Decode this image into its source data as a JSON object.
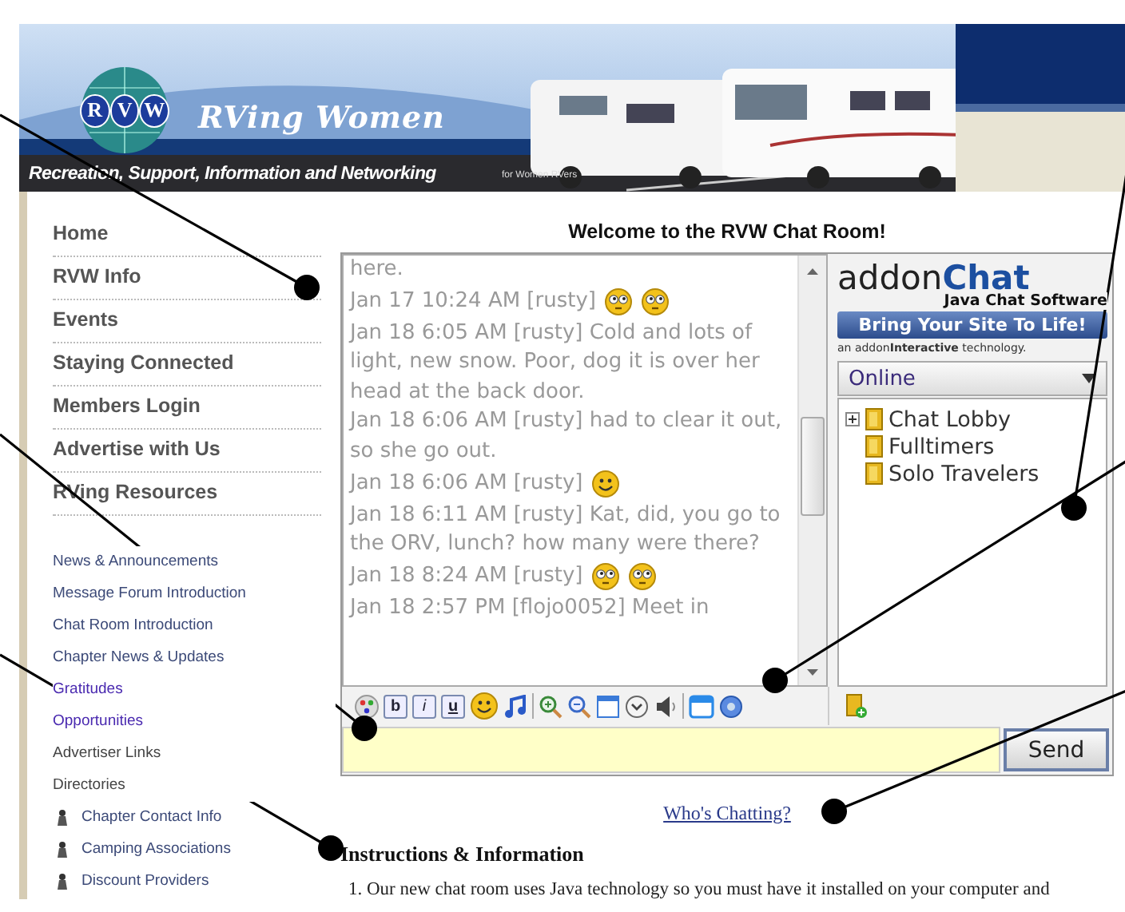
{
  "header": {
    "logo_letters": [
      "R",
      "V",
      "W"
    ],
    "site_name": "RVing Women",
    "tagline": "Recreation, Support, Information and Networking",
    "tagline_note": "for Women RVers"
  },
  "sidebar": {
    "nav": [
      {
        "label": "Home"
      },
      {
        "label": "RVW Info"
      },
      {
        "label": "Events"
      },
      {
        "label": "Staying Connected"
      },
      {
        "label": "Members Login"
      },
      {
        "label": "Advertise with Us"
      },
      {
        "label": "RVing Resources"
      }
    ],
    "links": [
      {
        "label": "News & Announcements",
        "kind": "link",
        "visited": false
      },
      {
        "label": "Message Forum Introduction",
        "kind": "link",
        "visited": false
      },
      {
        "label": "Chat Room Introduction",
        "kind": "link",
        "visited": false
      },
      {
        "label": "Chapter News & Updates",
        "kind": "link",
        "visited": false
      },
      {
        "label": "Gratitudes",
        "kind": "link",
        "visited": true
      },
      {
        "label": "Opportunities",
        "kind": "link",
        "visited": true
      },
      {
        "label": "Advertiser Links",
        "kind": "heading",
        "visited": false
      },
      {
        "label": "Directories",
        "kind": "heading",
        "visited": false
      },
      {
        "label": "Chapter Contact Info",
        "kind": "sub",
        "visited": false
      },
      {
        "label": "Camping Associations",
        "kind": "sub",
        "visited": false
      },
      {
        "label": "Discount Providers",
        "kind": "sub",
        "visited": false
      }
    ]
  },
  "main": {
    "title": "Welcome to the RVW Chat Room!",
    "chat": {
      "messages": [
        {
          "text": "here.",
          "kind": "text"
        },
        {
          "text": "Jan 17 10:24 AM [rusty]",
          "kind": "emote2"
        },
        {
          "text": "Jan 18 6:05 AM [rusty] Cold and lots of light, new snow. Poor, dog it is over her head at the back door.",
          "kind": "text"
        },
        {
          "text": "Jan 18 6:06 AM [rusty] had to clear it out, so she go out.",
          "kind": "text"
        },
        {
          "text": "Jan 18 6:06 AM [rusty]",
          "kind": "emote1"
        },
        {
          "text": "Jan 18 6:11 AM [rusty] Kat, did, you go to the ORV, lunch? how many were there?",
          "kind": "text"
        },
        {
          "text": "Jan 18 8:24 AM [rusty]",
          "kind": "emote2"
        },
        {
          "text": "Jan 18 2:57 PM [flojo0052] Meet in",
          "kind": "text"
        }
      ],
      "format_buttons": [
        "b",
        "i",
        "u"
      ],
      "brand": {
        "name": [
          "addon",
          "Chat"
        ],
        "tagline": "Java Chat Software",
        "banner": "Bring Your Site To Life!",
        "credit": "an addon**Interactive** technology."
      },
      "room_filter": "Online",
      "rooms": [
        {
          "name": "Chat Lobby",
          "expandable": true
        },
        {
          "name": "Fulltimers",
          "expandable": false
        },
        {
          "name": "Solo Travelers",
          "expandable": false
        }
      ],
      "send_label": "Send"
    },
    "whos_chatting": "Who's Chatting?",
    "instructions": {
      "heading": "Instructions & Information",
      "items": [
        "1. Our new chat room uses Java technology so you must have it installed on your computer and"
      ]
    }
  }
}
